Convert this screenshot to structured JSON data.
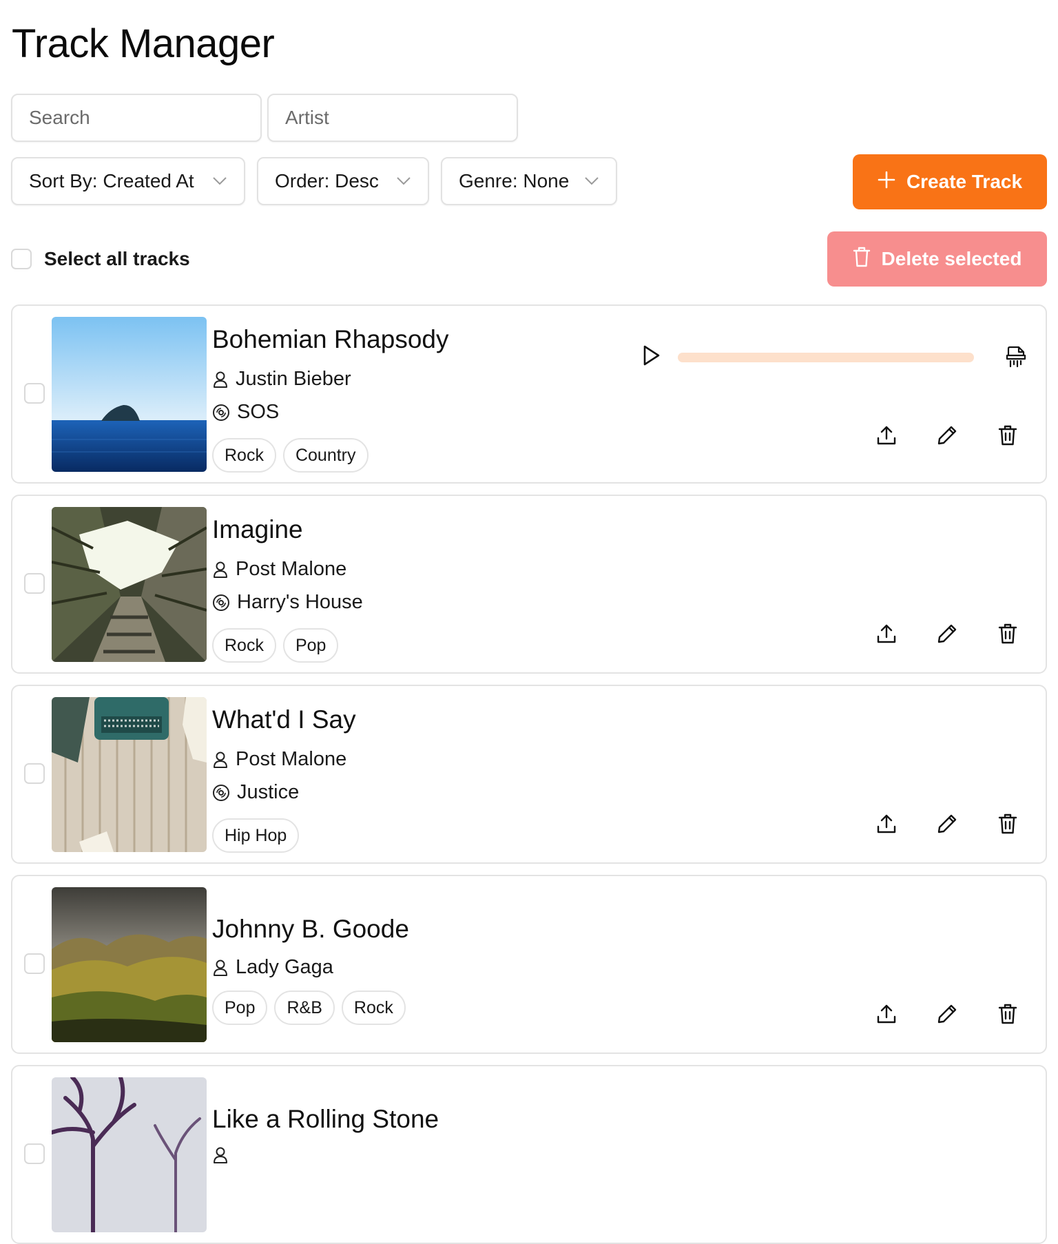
{
  "page": {
    "title": "Track Manager"
  },
  "filters": {
    "search_placeholder": "Search",
    "artist_placeholder": "Artist",
    "sort_label": "Sort By: Created At",
    "order_label": "Order: Desc",
    "genre_label": "Genre: None"
  },
  "toolbar": {
    "create_label": "Create Track",
    "delete_label": "Delete selected",
    "select_all_label": "Select all tracks"
  },
  "colors": {
    "accent": "#f97316",
    "danger_disabled": "#f78e8e",
    "progress_track": "#fde0cb"
  },
  "tracks": [
    {
      "title": "Bohemian Rhapsody",
      "artist": "Justin Bieber",
      "album": "SOS",
      "genres": [
        "Rock",
        "Country"
      ],
      "has_audio": true,
      "progress": 0,
      "checked": false
    },
    {
      "title": "Imagine",
      "artist": "Post Malone",
      "album": "Harry's House",
      "genres": [
        "Rock",
        "Pop"
      ],
      "has_audio": false,
      "checked": false
    },
    {
      "title": "What'd I Say",
      "artist": "Post Malone",
      "album": "Justice",
      "genres": [
        "Hip Hop"
      ],
      "has_audio": false,
      "checked": false
    },
    {
      "title": "Johnny B. Goode",
      "artist": "Lady Gaga",
      "album": "",
      "genres": [
        "Pop",
        "R&B",
        "Rock"
      ],
      "has_audio": false,
      "checked": false
    },
    {
      "title": "Like a Rolling Stone",
      "artist": "",
      "album": "",
      "genres": [],
      "has_audio": false,
      "checked": false
    }
  ]
}
